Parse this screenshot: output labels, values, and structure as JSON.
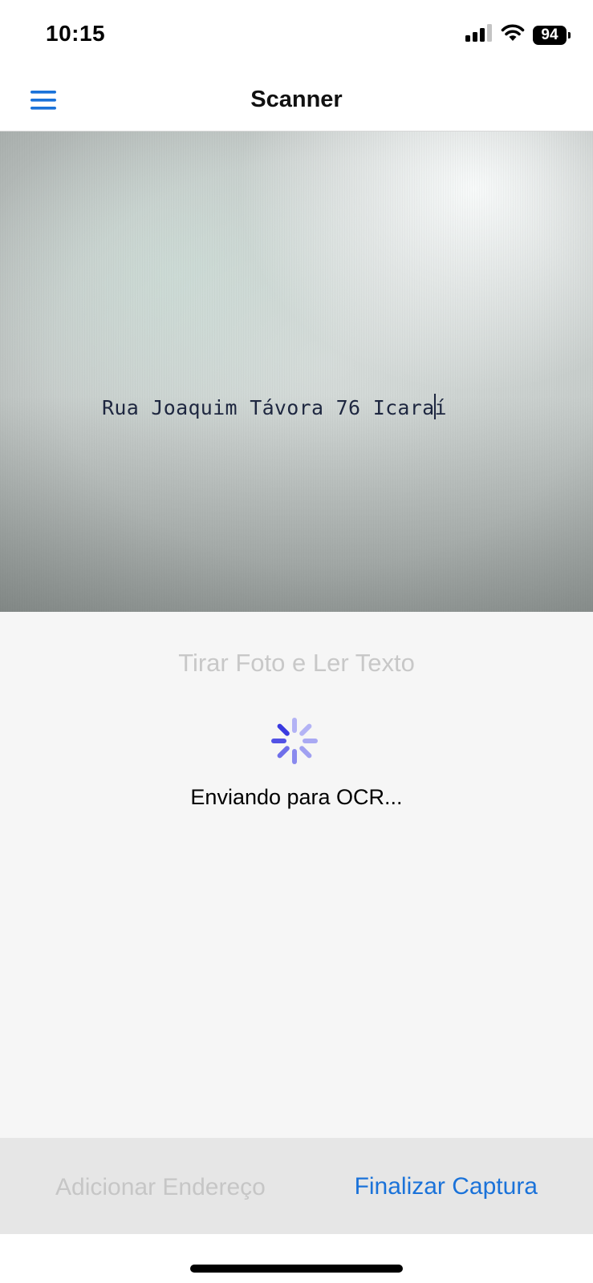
{
  "status_bar": {
    "time": "10:15",
    "battery_level": "94",
    "icons": [
      "signal-icon",
      "wifi-icon",
      "battery-icon"
    ]
  },
  "nav": {
    "title": "Scanner",
    "menu_icon": "hamburger-menu-icon",
    "accent_color": "#1a72d9"
  },
  "camera": {
    "scanned_text": "Rua Joaquim Távora 76 Icaraí"
  },
  "main": {
    "take_photo_label": "Tirar Foto e Ler Texto",
    "status_text": "Enviando para OCR...",
    "spinner_icon": "loading-spinner-icon",
    "spinner_color": "#3a3ae0"
  },
  "toolbar": {
    "add_address_label": "Adicionar Endereço",
    "finish_capture_label": "Finalizar Captura"
  }
}
